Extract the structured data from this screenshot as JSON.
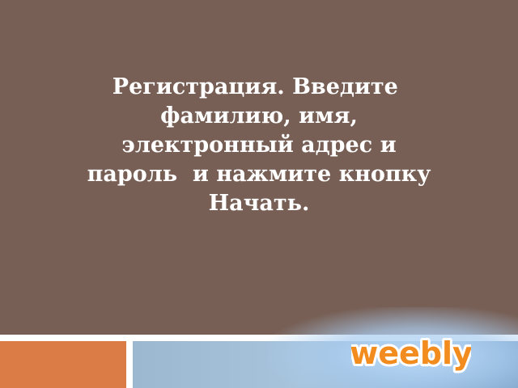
{
  "slide": {
    "text_lines": [
      "Регистрация. Введите ",
      "фамилию, имя,",
      "электронный адрес и",
      "пароль  и нажмите кнопку",
      "Начать."
    ]
  },
  "logo": {
    "text": "weebly",
    "fill_color": "#F28C1E",
    "outline_color": "#FFFFFF"
  },
  "colors": {
    "background": "#775F55",
    "text": "#FFFFFF",
    "footer_orange": "#DB7C46",
    "footer_blue": "#9CB7D0"
  }
}
